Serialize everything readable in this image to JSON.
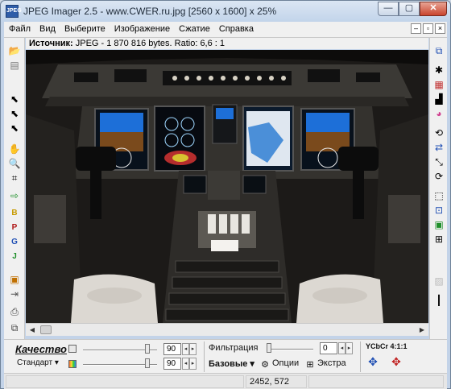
{
  "window": {
    "title": "JPEG Imager 2.5 - www.CWER.ru.jpg [2560 x 1600] x 25%",
    "app_icon_text": "JPEG",
    "minimize": "—",
    "maximize": "▢",
    "close": "✕"
  },
  "menu": {
    "items": [
      "Файл",
      "Вид",
      "Выберите",
      "Изображение",
      "Сжатие",
      "Справка"
    ]
  },
  "source": {
    "label": "Источник:",
    "info": "JPEG - 1 870 816 bytes. Ratio: 6,6 : 1"
  },
  "left_toolbar": {
    "icons": [
      "open-folder-icon",
      "save-icon",
      "select-arrow-icon",
      "select-plus-icon",
      "select-minus-icon",
      "hand-pan-icon",
      "zoom-icon",
      "crop-icon",
      "export-icon",
      "export-png-icon",
      "export-gif-icon",
      "export-jpg-icon",
      "paste-icon",
      "import-icon",
      "print-icon",
      "copy-icon"
    ]
  },
  "right_toolbar": {
    "icons": [
      "compare-icon",
      "sharpen-icon",
      "color-grid-icon",
      "histogram-icon",
      "color-wheel-icon",
      "rotate-icon",
      "flip-icon",
      "resize-icon",
      "refresh-icon",
      "frame-icon",
      "crop-select-icon",
      "preview-icon",
      "info-icon"
    ]
  },
  "quality": {
    "title": "Качество",
    "preset": "Стандарт",
    "luma_value": "90",
    "chroma_value": "90",
    "luma_level_percent": 90,
    "chroma_level_percent": 90
  },
  "filter": {
    "label": "Фильтрация",
    "value": "0",
    "level_percent": 0,
    "basic_label": "Базовые",
    "options_label": "Опции",
    "extra_label": "Экстра"
  },
  "subsampling": {
    "label": "YCbCr 4:1:1"
  },
  "status": {
    "zoom_hint": "",
    "coords": "2452, 572",
    "extra": ""
  },
  "colors": {
    "window_frame": "#c3d3e8",
    "close_button": "#c9452f",
    "toolbar_bg": "#f0f0f0"
  }
}
